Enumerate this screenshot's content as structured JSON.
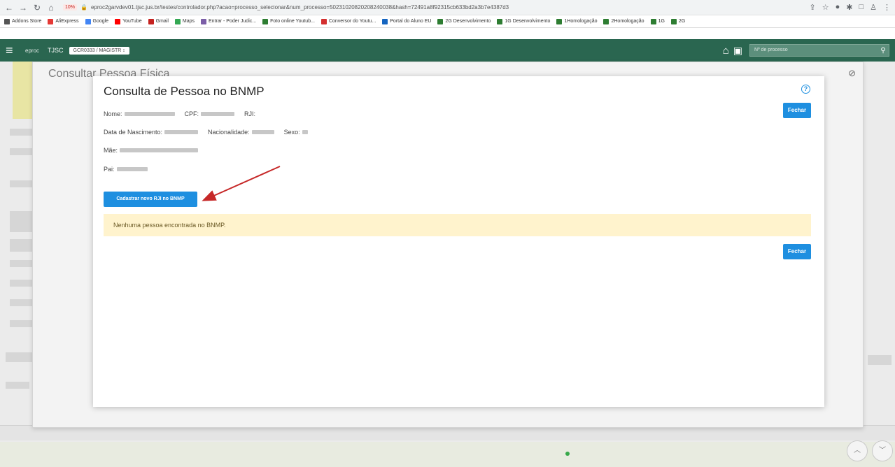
{
  "browser": {
    "url": "eproc2garvdev01.tjsc.jus.br/testes/controlador.php?acao=processo_selecionar&num_processo=50231020820208240038&hash=72491a8f92315cb633bd2a3b7e4387d3",
    "url_badge": "10%",
    "bookmarks": [
      {
        "label": "Addons Store",
        "color": "#555555"
      },
      {
        "label": "AliExpress",
        "color": "#e53935"
      },
      {
        "label": "Google",
        "color": "#4285f4"
      },
      {
        "label": "YouTube",
        "color": "#ff0000"
      },
      {
        "label": "Gmail",
        "color": "#c5221f"
      },
      {
        "label": "Maps",
        "color": "#34a853"
      },
      {
        "label": "Entrar - Poder Judic...",
        "color": "#7b5ea7"
      },
      {
        "label": "Foto online Youtub...",
        "color": "#2e7d32"
      },
      {
        "label": "Conversor do Youtu...",
        "color": "#d32f2f"
      },
      {
        "label": "Portal do Aluno EU",
        "color": "#1565c0"
      },
      {
        "label": "2G Desenvolvimento",
        "color": "#2e7d32"
      },
      {
        "label": "1G Desenvolvimento",
        "color": "#2e7d32"
      },
      {
        "label": "1Homologação",
        "color": "#2e7d32"
      },
      {
        "label": "2Homologação",
        "color": "#2e7d32"
      },
      {
        "label": "1G",
        "color": "#2e7d32"
      },
      {
        "label": "2G",
        "color": "#2e7d32"
      }
    ]
  },
  "header": {
    "logo": "eproc",
    "org": "TJSC",
    "unit": "GCR0333 / MAGISTR ↕",
    "search_placeholder": "Nº de processo"
  },
  "outer_modal": {
    "title": "Consultar Pessoa Física"
  },
  "bnmp_modal": {
    "title": "Consulta de Pessoa no BNMP",
    "labels": {
      "nome": "Nome:",
      "cpf": "CPF:",
      "rji": "RJI:",
      "nascimento": "Data de Nascimento:",
      "nacionalidade": "Nacionalidade:",
      "sexo": "Sexo:",
      "mae": "Mãe:",
      "pai": "Pai:"
    },
    "close_label": "Fechar",
    "register_label": "Cadastrar novo RJI no BNMP",
    "empty_message": "Nenhuma pessoa encontrada no BNMP."
  },
  "colors": {
    "header_green": "#2a6650",
    "primary_blue": "#1e8fe0",
    "alert_bg": "#fff3cd",
    "arrow_red": "#c62828"
  }
}
